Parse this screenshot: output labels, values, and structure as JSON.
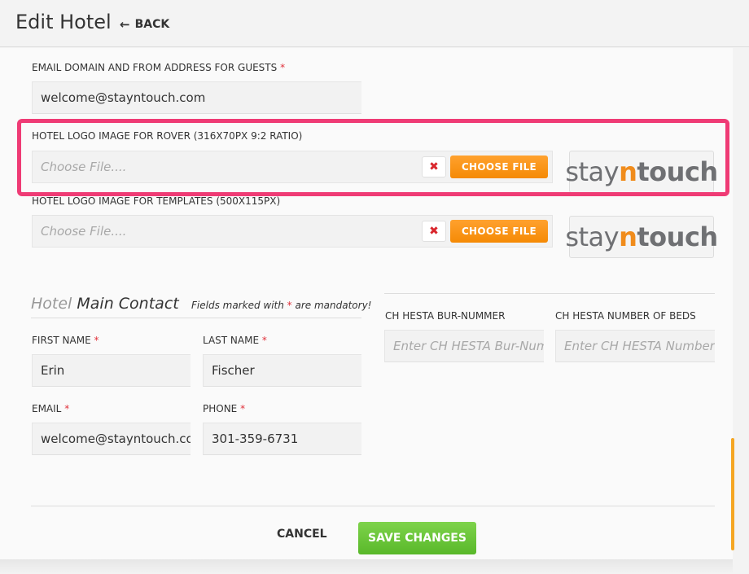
{
  "header": {
    "title": "Edit Hotel",
    "back_label": "BACK"
  },
  "email_domain": {
    "label": "EMAIL DOMAIN AND FROM ADDRESS FOR GUESTS",
    "required_mark": "*",
    "value": "welcome@stayntouch.com"
  },
  "logo_rover": {
    "label": "HOTEL LOGO IMAGE FOR ROVER (316X70PX 9:2 RATIO)",
    "placeholder": "Choose File....",
    "remove_icon": "✖",
    "choose_label": "CHOOSE FILE",
    "preview": {
      "part1": "stay",
      "part2": "n",
      "part3": "touch"
    }
  },
  "logo_templates": {
    "label": "HOTEL LOGO IMAGE FOR TEMPLATES (500X115PX)",
    "placeholder": "Choose File....",
    "remove_icon": "✖",
    "choose_label": "CHOOSE FILE",
    "preview": {
      "part1": "stay",
      "part2": "n",
      "part3": "touch"
    }
  },
  "main_contact": {
    "title_part1": "Hotel",
    "title_part2": "Main Contact",
    "note_prefix": "Fields marked with",
    "note_mark": "*",
    "note_suffix": "are mandatory!",
    "first_name": {
      "label": "FIRST NAME",
      "required_mark": "*",
      "value": "Erin"
    },
    "last_name": {
      "label": "LAST NAME",
      "required_mark": "*",
      "value": "Fischer"
    },
    "email": {
      "label": "EMAIL",
      "required_mark": "*",
      "value": "welcome@stayntouch.con"
    },
    "phone": {
      "label": "PHONE",
      "required_mark": "*",
      "value": "301-359-6731"
    }
  },
  "ch_hesta": {
    "bur_label": "CH HESTA BUR-NUMMER",
    "bur_placeholder": "Enter CH HESTA Bur-Numm",
    "beds_label": "CH HESTA NUMBER OF BEDS",
    "beds_placeholder": "Enter CH HESTA Number of"
  },
  "footer": {
    "cancel_label": "CANCEL",
    "save_label": "SAVE CHANGES"
  },
  "colors": {
    "accent_orange": "#f58a05",
    "save_green": "#59b82a",
    "highlight_pink": "#ef3b75",
    "required_red": "#e0303a"
  }
}
